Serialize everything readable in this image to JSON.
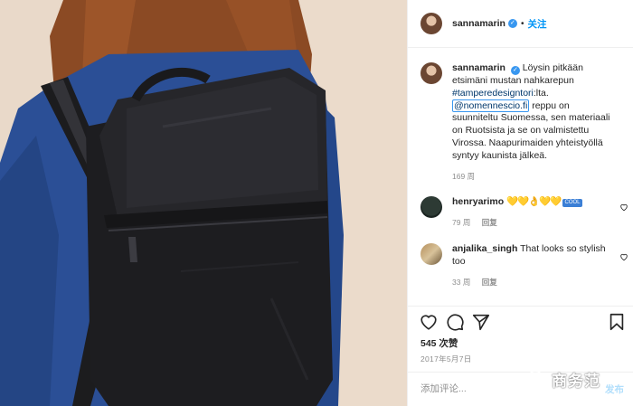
{
  "post": {
    "header": {
      "username": "sannamarin",
      "follow_label": "关注",
      "dot": "•"
    },
    "caption": {
      "username": "sannamarin",
      "text_1": "Löysin pitkään etsimäni mustan nahkarepun",
      "hashtag": "#tamperedesigntori",
      "text_2": ":lta.",
      "mention": "@nomennescio.fi",
      "text_3": "reppu on suunniteltu Suomessa, sen materiaali on Ruotsista ja se on valmistettu Virossa. Naapurimaiden yhteistyöllä syntyy kaunista jälkeä.",
      "age": "169 周"
    },
    "comments": [
      {
        "username": "henryarimo",
        "text": "💛💛👌💛💛",
        "badge": "COOL",
        "age": "79 周",
        "reply_label": "回复"
      },
      {
        "username": "anjalika_singh",
        "text": "That looks so stylish too",
        "age": "33 周",
        "reply_label": "回复"
      }
    ],
    "likes": "545 次赞",
    "date": "2017年5月7日",
    "add_comment": {
      "placeholder": "添加评论...",
      "post_label": "发布"
    },
    "watermark": "商务范"
  },
  "icons": {
    "verified": "verified-badge-icon",
    "like": "heart-icon",
    "comment": "comment-bubble-icon",
    "share": "paper-plane-icon",
    "save": "bookmark-icon"
  },
  "colors": {
    "link_blue": "#0095f6",
    "hashtag_navy": "#00376b",
    "muted": "#8e8e8e",
    "verified_blue": "#3897f0",
    "mention_border": "#3897f0"
  }
}
